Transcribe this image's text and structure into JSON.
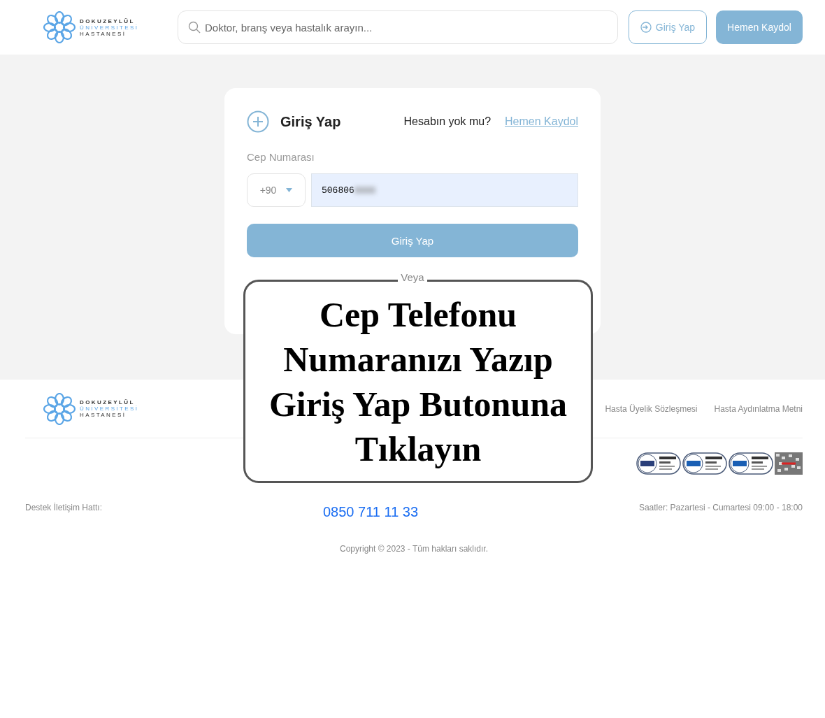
{
  "header": {
    "logo": {
      "line_1": "DOKUZEYLÜL",
      "line_2": "ÜNİVERSİTESİ",
      "line_3": "HASTANESİ"
    },
    "search": {
      "placeholder": "Doktor, branş veya hastalık arayın..."
    },
    "login_button": "Giriş Yap",
    "register_button": "Hemen Kaydol"
  },
  "login_card": {
    "title": "Giriş Yap",
    "prompt": "Hesabın yok mu?",
    "register_link": "Hemen Kaydol",
    "phone_label": "Cep Numarası",
    "country_code": "+90",
    "phone_value": "506806",
    "submit": "Giriş Yap",
    "divider": "Veya"
  },
  "overlay": {
    "caption": "Cep Telefonu Numaranızı Yazıp Giriş Yap Butonuna Tıklayın"
  },
  "footer": {
    "logo": {
      "line_1": "DOKUZEYLÜL",
      "line_2": "ÜNİVERSİTESİ",
      "line_3": "HASTANESİ"
    },
    "links": [
      "Hasta Üyelik Sözleşmesi",
      "Hasta Aydınlatma Metni"
    ],
    "support_label": "Destek İletişim Hattı:",
    "support_phone": "0850 711 11 33",
    "hours": "Saatler: Pazartesi - Cumartesi 09:00 - 18:00",
    "copyright": "Copyright © 2023 - Tüm hakları saklıdır."
  }
}
